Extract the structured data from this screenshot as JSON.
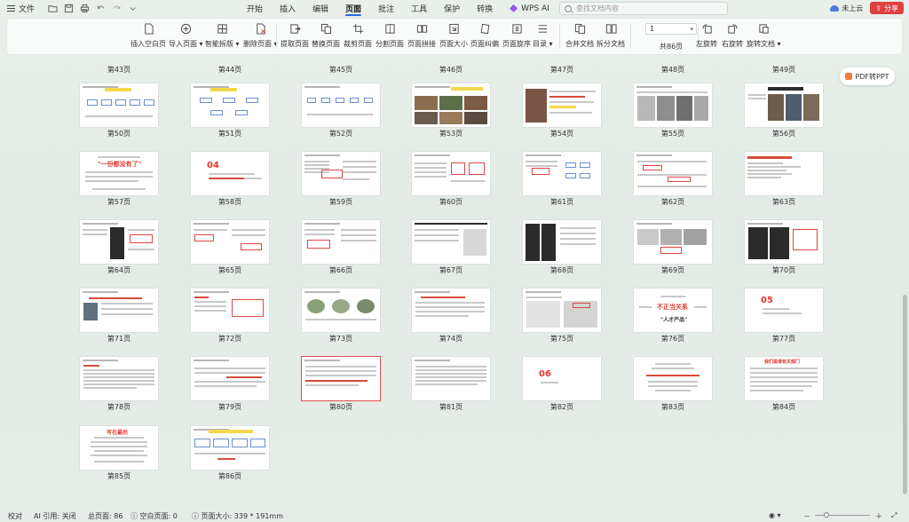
{
  "topbar": {
    "file_label": "文件",
    "tabs": [
      "开始",
      "插入",
      "编辑",
      "页面",
      "批注",
      "工具",
      "保护",
      "转换",
      "WPS AI"
    ],
    "active_tab": "页面",
    "search_placeholder": "查找文档内容",
    "cloud_label": "未上云",
    "share_label": "分享"
  },
  "ribbon": {
    "buttons": [
      {
        "label": "插入空白页",
        "icon": "blank-page-icon"
      },
      {
        "label": "导入页面 ▾",
        "icon": "import-page-icon"
      },
      {
        "label": "智能拆版 ▾",
        "icon": "smart-split-icon"
      },
      {
        "label": "删除页面 ▾",
        "icon": "delete-page-icon"
      },
      {
        "label": "提取页面",
        "icon": "extract-page-icon"
      },
      {
        "label": "替换页面",
        "icon": "replace-page-icon"
      },
      {
        "label": "裁剪页面",
        "icon": "crop-page-icon"
      },
      {
        "label": "分割页面",
        "icon": "split-page-icon"
      },
      {
        "label": "页面拼接",
        "icon": "merge-page-icon"
      },
      {
        "label": "页面大小",
        "icon": "page-size-icon"
      },
      {
        "label": "页面纠偏",
        "icon": "deskew-icon"
      },
      {
        "label": "页面旋序",
        "icon": "page-order-icon"
      },
      {
        "label": "目录 ▾",
        "icon": "toc-icon"
      },
      {
        "label": "合并文档",
        "icon": "merge-doc-icon"
      },
      {
        "label": "拆分文档",
        "icon": "split-doc-icon"
      },
      {
        "label": "左旋转",
        "icon": "rotate-left-icon"
      },
      {
        "label": "右旋转",
        "icon": "rotate-right-icon"
      },
      {
        "label": "旋转文档 ▾",
        "icon": "rotate-doc-icon"
      }
    ],
    "page_input_value": "1",
    "total_pages": "共86页"
  },
  "side": {
    "pdf_to_ppt": "PDF转PPT"
  },
  "pages": {
    "top_row_labels": [
      "第43页",
      "第44页",
      "第45页",
      "第46页",
      "第47页",
      "第48页",
      "第49页"
    ],
    "rows": [
      [
        "第50页",
        "第51页",
        "第52页",
        "第53页",
        "第54页",
        "第55页",
        "第56页"
      ],
      [
        "第57页",
        "第58页",
        "第59页",
        "第60页",
        "第61页",
        "第62页",
        "第63页"
      ],
      [
        "第64页",
        "第65页",
        "第66页",
        "第67页",
        "第68页",
        "第69页",
        "第70页"
      ],
      [
        "第71页",
        "第72页",
        "第73页",
        "第74页",
        "第75页",
        "第76页",
        "第77页"
      ],
      [
        "第78页",
        "第79页",
        "第80页",
        "第81页",
        "第82页",
        "第83页",
        "第84页"
      ],
      [
        "第85页",
        "第86页"
      ]
    ],
    "selected": "第80页",
    "thumb_text": {
      "p57_red": "\"一份都没有了\"",
      "p58_num": "04",
      "p76_red": "不正当关系",
      "p76_bold": "\"人才产品\"",
      "p77_num": "05",
      "p82_num": "06",
      "p84_title": "我们是谁有关部门",
      "p85_title": "写在最后"
    }
  },
  "status": {
    "proofread": "校对",
    "ai_quote": "AI 引用: 关闭",
    "total_pages": "总页面: 86",
    "blank_pages": "空白页面: 0",
    "page_size": "页面大小: 339 * 191mm"
  }
}
